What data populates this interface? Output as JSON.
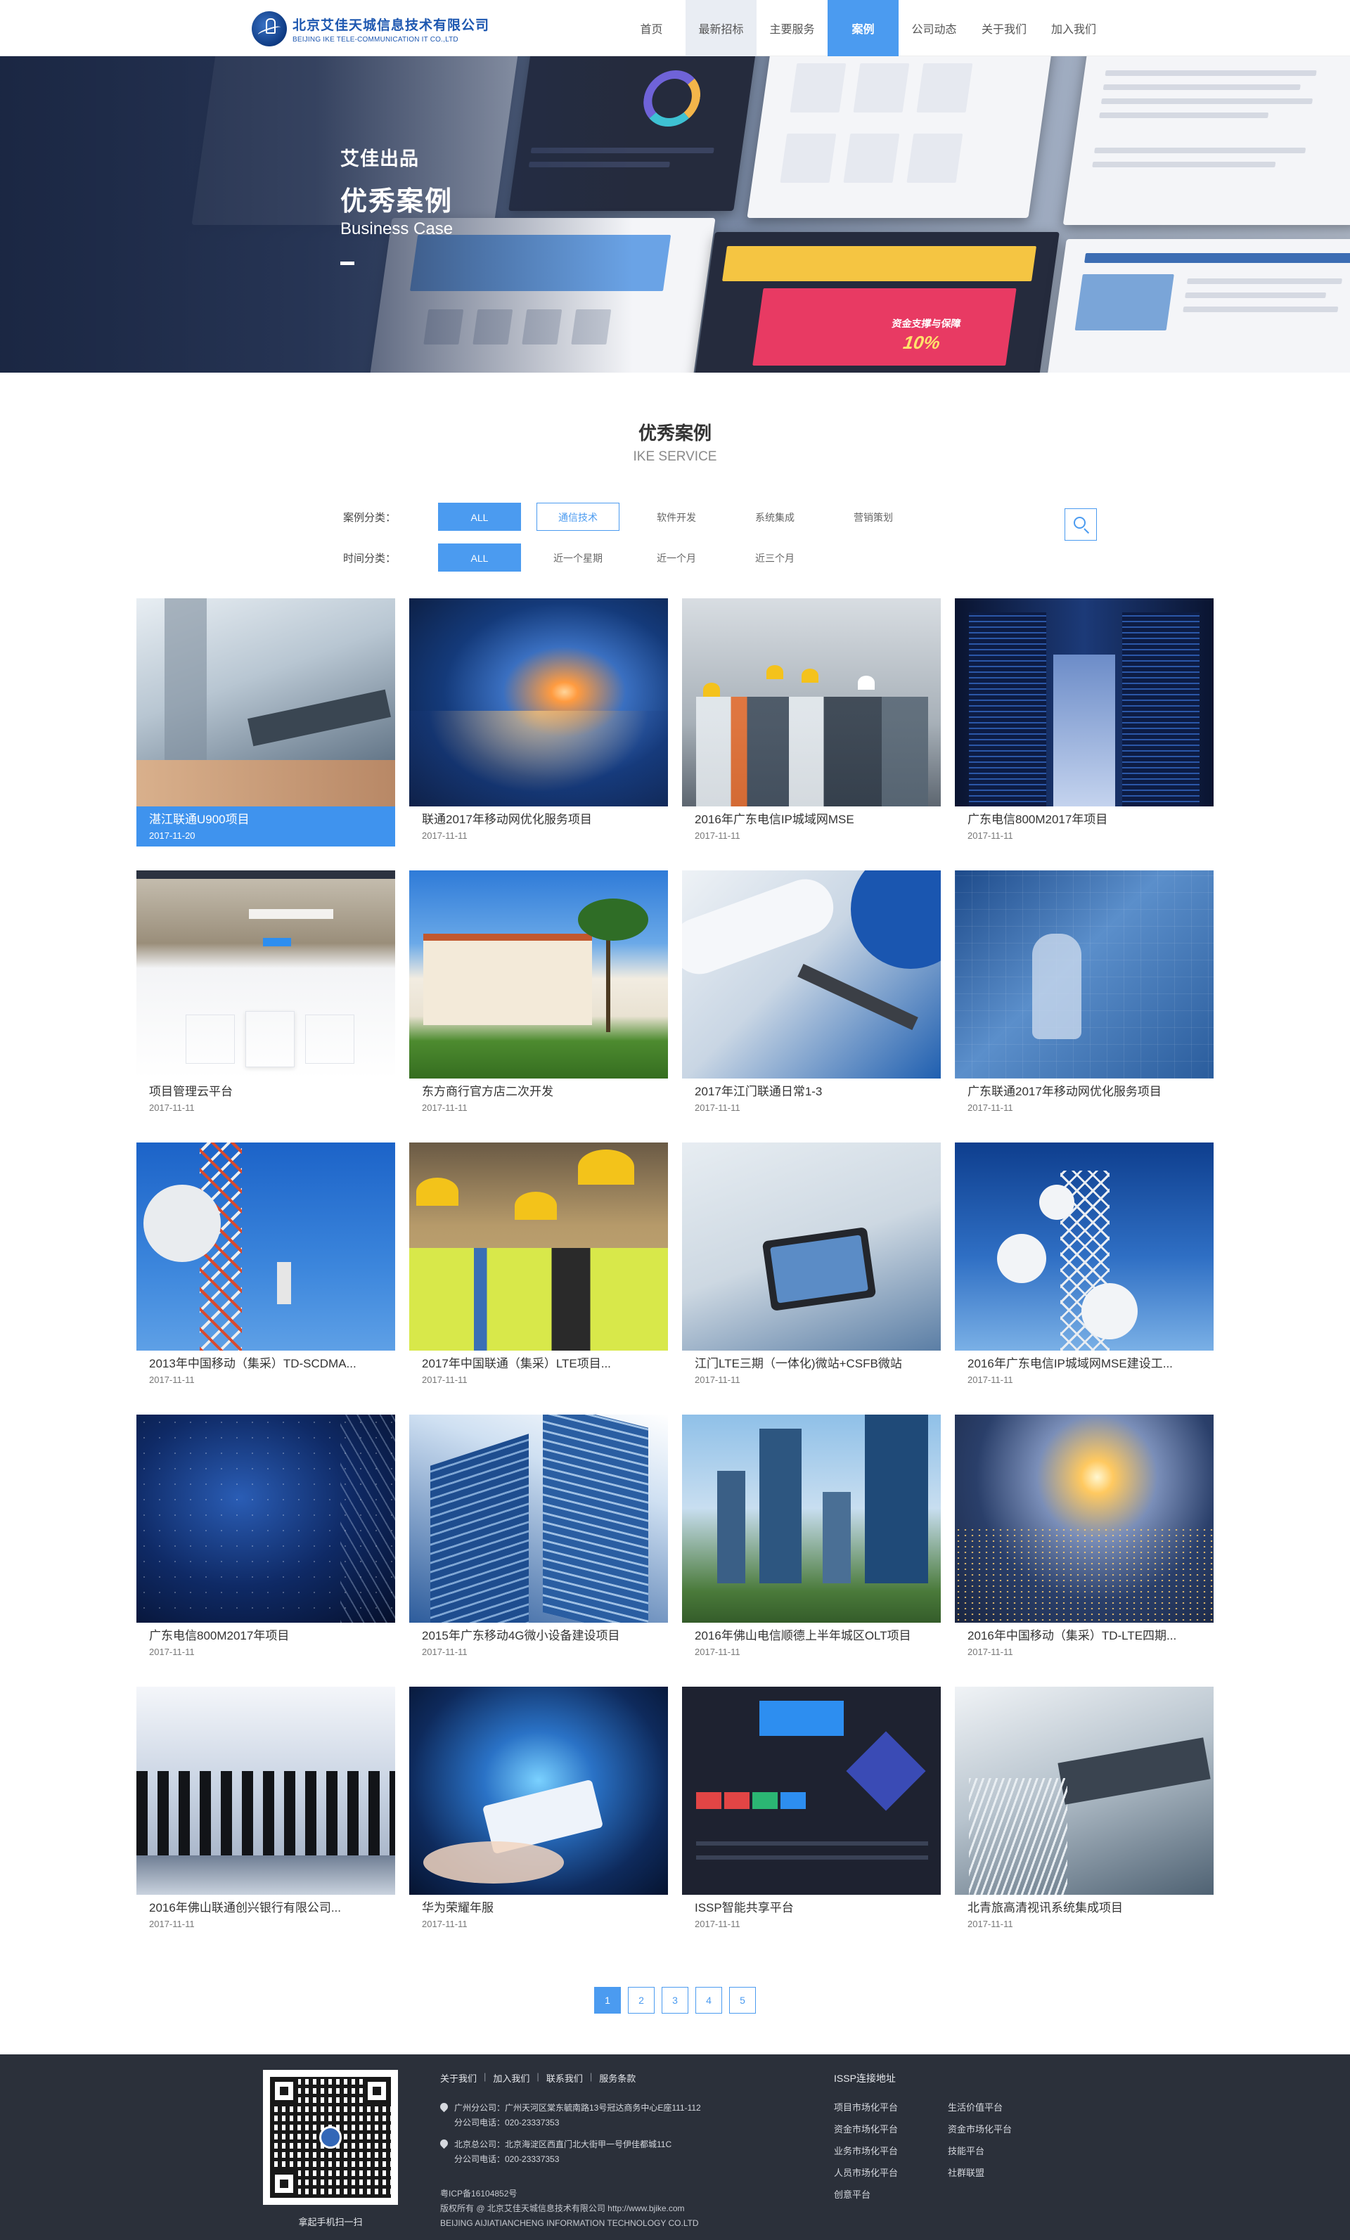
{
  "header": {
    "logo_cn": "北京艾佳天城信息技术有限公司",
    "logo_en": "BEIJING IKE TELE-COMMUNICATION IT CO.,LTD",
    "nav": [
      {
        "label": "首页"
      },
      {
        "label": "最新招标"
      },
      {
        "label": "主要服务"
      },
      {
        "label": "案例"
      },
      {
        "label": "公司动态"
      },
      {
        "label": "关于我们"
      },
      {
        "label": "加入我们"
      }
    ]
  },
  "banner": {
    "subtitle": "艾佳出品",
    "title": "优秀案例",
    "title_en": "Business Case",
    "mock_text": "资金支撑与保障",
    "mock_percent": "10%"
  },
  "section": {
    "title": "优秀案例",
    "subtitle": "IKE SERVICE"
  },
  "filters": {
    "category_label": "案例分类：",
    "category_options": [
      "ALL",
      "通信技术",
      "软件开发",
      "系统集成",
      "营销策划"
    ],
    "time_label": "时间分类：",
    "time_options": [
      "ALL",
      "近一个星期",
      "近一个月",
      "近三个月"
    ]
  },
  "cases": [
    {
      "title": "湛江联通U900项目",
      "date": "2017-11-20"
    },
    {
      "title": "联通2017年移动网优化服务项目",
      "date": "2017-11-11"
    },
    {
      "title": "2016年广东电信IP城域网MSE",
      "date": "2017-11-11"
    },
    {
      "title": "广东电信800M2017年项目",
      "date": "2017-11-11"
    },
    {
      "title": "项目管理云平台",
      "date": "2017-11-11"
    },
    {
      "title": "东方商行官方店二次开发",
      "date": "2017-11-11"
    },
    {
      "title": "2017年江门联通日常1-3",
      "date": "2017-11-11"
    },
    {
      "title": "广东联通2017年移动网优化服务项目",
      "date": "2017-11-11"
    },
    {
      "title": "2013年中国移动（集采）TD-SCDMA...",
      "date": "2017-11-11"
    },
    {
      "title": "2017年中国联通（集采）LTE项目...",
      "date": "2017-11-11"
    },
    {
      "title": "江门LTE三期（一体化)微站+CSFB微站",
      "date": "2017-11-11"
    },
    {
      "title": "2016年广东电信IP城域网MSE建设工...",
      "date": "2017-11-11"
    },
    {
      "title": "广东电信800M2017年项目",
      "date": "2017-11-11"
    },
    {
      "title": "2015年广东移动4G微小设备建设项目",
      "date": "2017-11-11"
    },
    {
      "title": "2016年佛山电信顺德上半年城区OLT项目",
      "date": "2017-11-11"
    },
    {
      "title": "2016年中国移动（集采）TD-LTE四期...",
      "date": "2017-11-11"
    },
    {
      "title": "2016年佛山联通创兴银行有限公司...",
      "date": "2017-11-11"
    },
    {
      "title": "华为荣耀年服",
      "date": "2017-11-11"
    },
    {
      "title": "ISSP智能共享平台",
      "date": "2017-11-11"
    },
    {
      "title": "北青旅高清视讯系统集成项目",
      "date": "2017-11-11"
    }
  ],
  "pagination": [
    "1",
    "2",
    "3",
    "4",
    "5"
  ],
  "footer": {
    "qr_caption": "拿起手机扫一扫",
    "links": [
      "关于我们",
      "加入我们",
      "联系我们",
      "服务条款"
    ],
    "offices": [
      {
        "address": "广州分公司：广州天河区棠东毓南路13号冠达商务中心E座111-112",
        "phone": "分公司电话：020-23337353"
      },
      {
        "address": "北京总公司：北京海淀区西直门北大街甲一号伊佳都城11C",
        "phone": "分公司电话：020-23337353"
      }
    ],
    "icp": "粤ICP备16104852号",
    "copyright": "版权所有 @ 北京艾佳天城信息技术有限公司 http://www.bjike.com",
    "copyright_en": "BEIJING AIJIATIANCHENG INFORMATION TECHNOLOGY CO.LTD",
    "issp_title": "ISSP连接地址",
    "issp_links": [
      "项目市场化平台",
      "生活价值平台",
      "资金市场化平台",
      "资金市场化平台",
      "业务市场化平台",
      "技能平台",
      "人员市场化平台",
      "社群联盟",
      "创意平台"
    ]
  }
}
